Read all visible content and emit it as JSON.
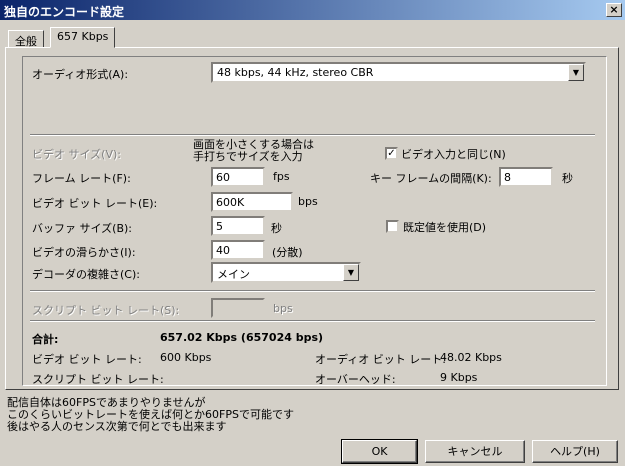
{
  "window": {
    "title": "独自のエンコード設定",
    "close_glyph": "×"
  },
  "tabs": [
    {
      "label": "全般"
    },
    {
      "label": "657 Kbps"
    }
  ],
  "audio": {
    "label": "オーディオ形式(A):",
    "value": "48 kbps, 44 kHz, stereo CBR"
  },
  "video": {
    "size_label": "ビデオ サイズ(V):",
    "size_note_line1": "画面を小さくする場合は",
    "size_note_line2": "手打ちでサイズを入力",
    "same_as_input_label": "ビデオ入力と同じ(N)",
    "same_as_input_checked": true,
    "frame_rate_label": "フレーム レート(F):",
    "frame_rate_value": "60",
    "frame_rate_unit": "fps",
    "keyframe_label": "キー フレームの間隔(K):",
    "keyframe_value": "8",
    "keyframe_unit": "秒",
    "bitrate_label": "ビデオ ビット レート(E):",
    "bitrate_value": "600K",
    "bitrate_unit": "bps",
    "buffer_label": "バッファ サイズ(B):",
    "buffer_value": "5",
    "buffer_unit": "秒",
    "use_default_label": "既定値を使用(D)",
    "use_default_checked": false,
    "smoothness_label": "ビデオの滑らかさ(I):",
    "smoothness_value": "40",
    "smoothness_unit": "(分散)",
    "decoder_label": "デコーダの複雑さ(C):",
    "decoder_value": "メイン"
  },
  "script": {
    "label": "スクリプト ビット レート(S):",
    "value": "",
    "unit": "bps"
  },
  "summary": {
    "total_label": "合計:",
    "total_value": "657.02 Kbps (657024 bps)",
    "video_bitrate_label": "ビデオ ビット レート:",
    "video_bitrate_value": "600 Kbps",
    "script_bitrate_label": "スクリプト ビット レート:",
    "audio_bitrate_label": "オーディオ ビット レート:",
    "audio_bitrate_value": "48.02 Kbps",
    "overhead_label": "オーバーヘッド:",
    "overhead_value": "9 Kbps"
  },
  "notes": [
    "配信自体は60FPSであまりやりませんが",
    "このくらいビットレートを使えば何とか60FPSで可能です",
    "後はやる人のセンス次第で何とでも出来ます"
  ],
  "buttons": {
    "ok": "OK",
    "cancel": "キャンセル",
    "help": "ヘルプ(H)"
  }
}
